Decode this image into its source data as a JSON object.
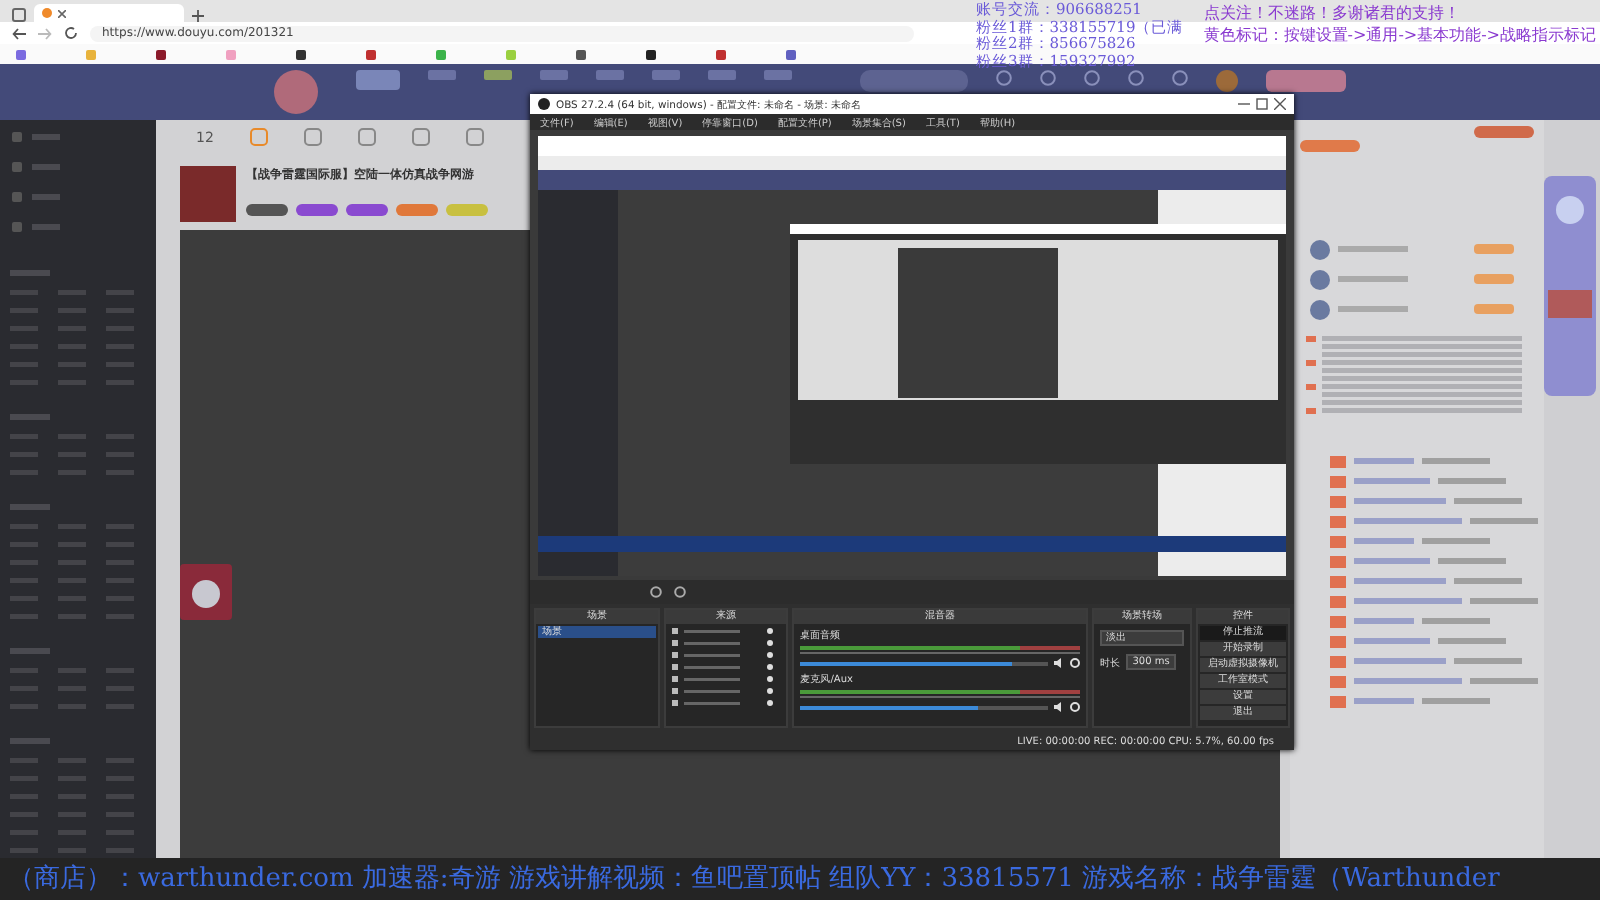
{
  "browser": {
    "url": "https://www.douyu.com/201321"
  },
  "site_header": {
    "count": "12"
  },
  "stream": {
    "title": "【战争雷霆国际服】空陆一体仿真战争网游"
  },
  "overlay": {
    "left_lines": [
      "账号交流：906688251",
      "粉丝1群：338155719（已满",
      "粉丝2群：856675826",
      "粉丝3群：159327992"
    ],
    "right_lines": [
      "点关注！不迷路！多谢诸君的支持！",
      "黄色标记：按键设置->通用->基本功能->战略指示标记"
    ]
  },
  "obs": {
    "title": "OBS 27.2.4 (64 bit, windows) - 配置文件: 未命名 - 场景: 未命名",
    "menu": [
      "文件(F)",
      "编辑(E)",
      "视图(V)",
      "停靠窗口(D)",
      "配置文件(P)",
      "场景集合(S)",
      "工具(T)",
      "帮助(H)"
    ],
    "docks": [
      "场景",
      "来源",
      "混音器",
      "场景转场",
      "控件"
    ],
    "scenes": [
      {
        "name": "场景",
        "selected": true
      }
    ],
    "mixer": [
      {
        "name": "桌面音频",
        "level": 0.85
      },
      {
        "name": "麦克风/Aux",
        "level": 0.72
      }
    ],
    "transition": {
      "type": "淡出",
      "duration_label": "时长",
      "duration": "300 ms"
    },
    "controls": [
      "停止推流",
      "开始录制",
      "启动虚拟摄像机",
      "工作室模式",
      "设置",
      "退出"
    ],
    "status": "LIVE: 00:00:00   REC: 00:00:00   CPU: 5.7%, 60.00 fps"
  },
  "ticker": "（商店）：warthunder.com  加速器:奇游  游戏讲解视频：鱼吧置顶帖  组队YY：33815571  游戏名称：战争雷霆（Warthunder"
}
